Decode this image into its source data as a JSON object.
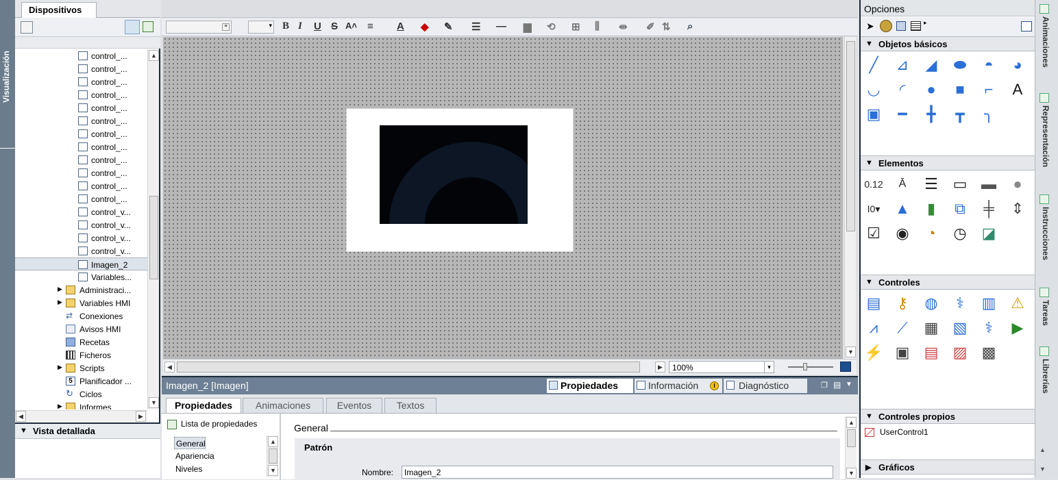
{
  "left_vtab": {
    "label": "Visualización"
  },
  "project": {
    "tab": "Dispositivos",
    "items": [
      "control_...",
      "control_...",
      "control_...",
      "control_...",
      "control_...",
      "control_...",
      "control_...",
      "control_...",
      "control_...",
      "control_...",
      "control_...",
      "control_...",
      "control_v...",
      "control_v...",
      "control_v...",
      "control_v...",
      "Imagen_2",
      "Variables..."
    ],
    "folders": [
      "Administraci...",
      "Variables HMI",
      "Conexiones",
      "Avisos HMI",
      "Recetas",
      "Ficheros",
      "Scripts",
      "Planificador ...",
      "Ciclos",
      "Informes"
    ]
  },
  "detail": {
    "title": "Vista detallada"
  },
  "editor": {
    "zoom": "100%",
    "toolbar_font": "",
    "toolbar_size": ""
  },
  "inspector": {
    "title": "Imagen_2 [Imagen]",
    "header_tabs": [
      "Propiedades",
      "Información",
      "Diagnóstico"
    ],
    "tabs": [
      "Propiedades",
      "Animaciones",
      "Eventos",
      "Textos"
    ],
    "prop_list": "Lista de propiedades",
    "nav": [
      "General",
      "Apariencia",
      "Niveles"
    ],
    "section": "General",
    "group": "Patrón",
    "name_label": "Nombre:",
    "name_value": "Imagen_2"
  },
  "options": {
    "title": "Opciones",
    "sections": [
      "Objetos básicos",
      "Elementos",
      "Controles",
      "Controles propios",
      "Gráficos"
    ],
    "user_control": "UserControl1"
  },
  "right_tabs": [
    "Animaciones",
    "Representación",
    "Instrucciones",
    "Tareas",
    "Librerías"
  ]
}
